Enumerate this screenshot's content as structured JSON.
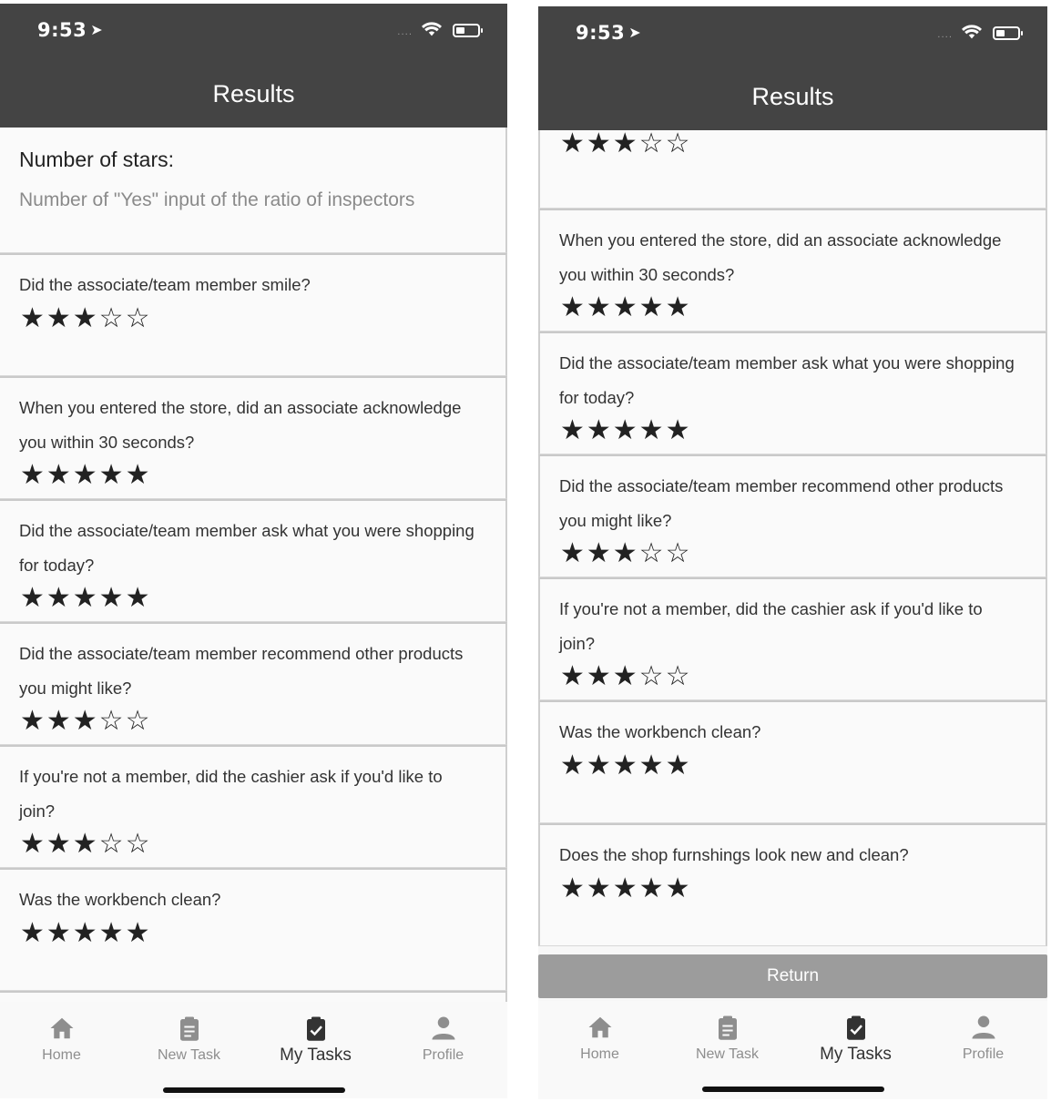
{
  "colors": {
    "header_bg": "#444444",
    "star": "#222222",
    "return_button_bg": "#9c9c9c"
  },
  "status": {
    "time": "9:53",
    "location_icon": "location-arrow-icon",
    "signal_dots": "....",
    "wifi_icon": "wifi-icon",
    "battery_icon": "battery-icon"
  },
  "nav": {
    "title": "Results"
  },
  "legend": {
    "title": "Number of stars:",
    "subtitle": "Number of \"Yes\" input of the ratio of inspectors"
  },
  "questions": [
    {
      "text": "Did the associate/team member smile?",
      "rating": 3,
      "stars": "★★★☆☆"
    },
    {
      "text": "When you entered the store, did an associate acknowledge you within 30 seconds?",
      "rating": 5,
      "stars": "★★★★★"
    },
    {
      "text": "Did the associate/team member ask what you were shopping for today?",
      "rating": 5,
      "stars": "★★★★★"
    },
    {
      "text": "Did the associate/team member recommend other products you might like?",
      "rating": 3,
      "stars": "★★★☆☆"
    },
    {
      "text": "If you're not a member, did the cashier ask if you'd like to join?",
      "rating": 3,
      "stars": "★★★☆☆"
    },
    {
      "text": "Was the workbench clean?",
      "rating": 5,
      "stars": "★★★★★"
    },
    {
      "text": "Does the shop furnshings look new and clean?",
      "rating": 5,
      "stars": "★★★★★"
    }
  ],
  "return_button": {
    "label": "Return"
  },
  "tabs": [
    {
      "label": "Home",
      "icon": "home-icon",
      "active": false
    },
    {
      "label": "New Task",
      "icon": "clipboard-icon",
      "active": false
    },
    {
      "label": "My Tasks",
      "icon": "clipboard-check-icon",
      "active": true
    },
    {
      "label": "Profile",
      "icon": "person-icon",
      "active": false
    }
  ]
}
